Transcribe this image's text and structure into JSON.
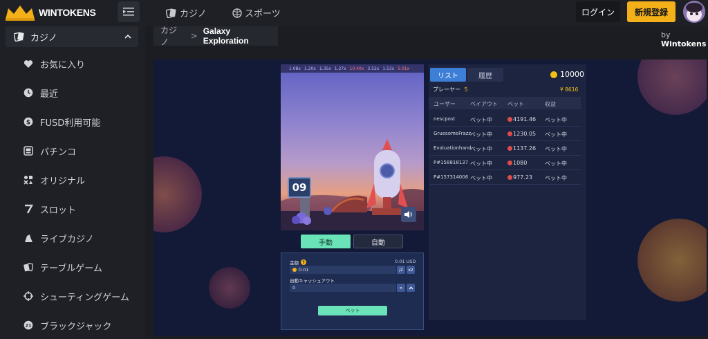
{
  "header": {
    "brand": "WINTOKENS",
    "nav": [
      {
        "label": "カジノ",
        "icon": "cards-icon"
      },
      {
        "label": "スポーツ",
        "icon": "ball-icon"
      }
    ],
    "login_label": "ログイン",
    "signup_label": "新規登録"
  },
  "sidebar": {
    "section_label": "カジノ",
    "items": [
      {
        "label": "お気に入り",
        "icon": "heart-icon"
      },
      {
        "label": "最近",
        "icon": "clock-icon"
      },
      {
        "label": "FUSD利用可能",
        "icon": "dollar-icon"
      },
      {
        "label": "パチンコ",
        "icon": "pachinko-icon"
      },
      {
        "label": "オリジナル",
        "icon": "original-icon"
      },
      {
        "label": "スロット",
        "icon": "seven-icon"
      },
      {
        "label": "ライブカジノ",
        "icon": "live-icon"
      },
      {
        "label": "テーブルゲーム",
        "icon": "table-cards-icon"
      },
      {
        "label": "シューティングゲーム",
        "icon": "crosshair-icon"
      },
      {
        "label": "ブラックジャック",
        "icon": "twentyone-icon"
      }
    ]
  },
  "breadcrumb": {
    "parent": "カジノ",
    "separator": ">",
    "current": "Galaxy Exploration"
  },
  "provider": {
    "prefix": "by",
    "name": "Wintokens"
  },
  "game": {
    "multipliers": [
      "1.08x",
      "1.20x",
      "1.35x",
      "1.27x",
      "10.40x",
      "3.52x",
      "1.53x",
      "5.01x"
    ],
    "timer": "09"
  },
  "modes": {
    "manual": "手動",
    "auto": "自動"
  },
  "bet_panel": {
    "amount_label": "金額",
    "amount_hint": "0.01 USD",
    "amount_value": "0.01",
    "half": "/2",
    "double": "x2",
    "cashout_label": "自動キャッシュアウト",
    "cashout_value": "0",
    "infinity": "∞",
    "bet_label": "ベット"
  },
  "players_panel": {
    "tab_list": "リスト",
    "tab_history": "履歴",
    "balance": "10000",
    "players_label": "プレーヤー",
    "players_count": "5",
    "total": "¥ 8616",
    "columns": [
      "ユーザー",
      "ペイアウト",
      "ベット",
      "収益"
    ],
    "rows": [
      {
        "user": "nescpost",
        "payout": "ベット中",
        "bet": "4191.46",
        "profit": "ベット中"
      },
      {
        "user": "GruesomeFrazz",
        "payout": "ベット中",
        "bet": "1230.05",
        "profit": "ベット中"
      },
      {
        "user": "Evaluationhand",
        "payout": "ベット中",
        "bet": "1137.26",
        "profit": "ベット中"
      },
      {
        "user": "P#158818137",
        "payout": "ベット中",
        "bet": "1080",
        "profit": "ベット中"
      },
      {
        "user": "P#157314006",
        "payout": "ベット中",
        "bet": "977.23",
        "profit": "ベット中"
      }
    ]
  },
  "colors": {
    "accent_gold": "#f3b019",
    "accent_mint": "#6be3b8",
    "tab_active": "#3d7fd6"
  }
}
